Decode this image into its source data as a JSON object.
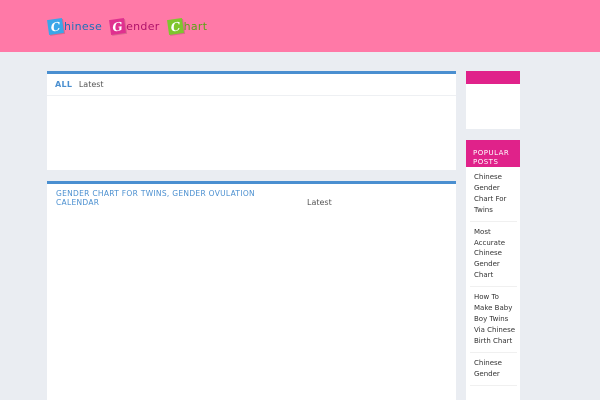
{
  "header": {
    "logo": {
      "words": [
        {
          "initial": "C",
          "rest": "hinese"
        },
        {
          "initial": "G",
          "rest": "ender"
        },
        {
          "initial": "C",
          "rest": "hart"
        }
      ]
    },
    "colors": {
      "background": "#ff79a7"
    }
  },
  "main": {
    "top_panel": {
      "tab_active": "ALL",
      "tab_other": "Latest"
    },
    "post": {
      "title": "Gender Chart For Twins, Gender Ovulation Calendar",
      "tab": "Latest"
    }
  },
  "sidebar": {
    "popular": {
      "heading": "Popular Posts",
      "items": [
        {
          "label": "Chinese Gender Chart For Twins"
        },
        {
          "label": "Most Accurate Chinese Gender Chart"
        },
        {
          "label": "How To Make Baby Boy Twins Via Chinese Birth Chart"
        },
        {
          "label": "Chinese Gender"
        }
      ]
    },
    "colors": {
      "accent": "#e0228a"
    }
  },
  "colors": {
    "link": "#4a8fd0",
    "page_background": "#eaedf2"
  }
}
